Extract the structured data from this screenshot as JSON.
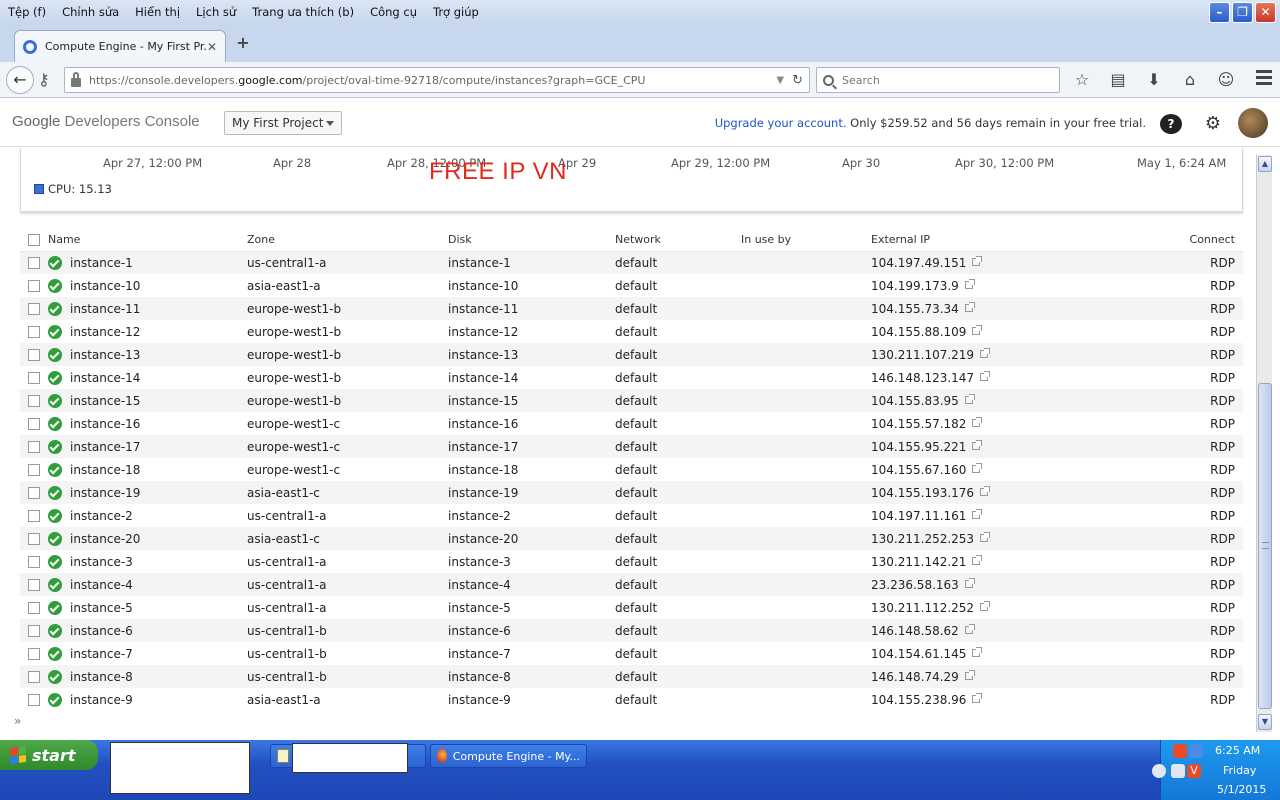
{
  "menubar": {
    "items": [
      "Tệp (f)",
      "Chỉnh sửa",
      "Hiển thị",
      "Lịch sử",
      "Trang ưa thích (b)",
      "Công cụ",
      "Trợ giúp"
    ]
  },
  "tab": {
    "title": "Compute Engine - My First Pr..."
  },
  "address_bar": {
    "url_prefix": "https://console.developers.",
    "url_domain": "google.com",
    "url_suffix": "/project/oval-time-92718/compute/instances?graph=GCE_CPU"
  },
  "search": {
    "placeholder": "Search"
  },
  "console": {
    "brand_google": "Google",
    "brand_product": "Developers Console",
    "project": "My First Project",
    "upgrade_link": "Upgrade your account.",
    "trial_text": " Only $259.52 and 56 days remain in your free trial."
  },
  "chart": {
    "x_ticks": [
      "Apr 27, 12:00 PM",
      "Apr 28",
      "Apr 28, 12:00 PM",
      "Apr 29",
      "Apr 29, 12:00 PM",
      "Apr 30",
      "Apr 30, 12:00 PM",
      "May 1, 6:24 AM"
    ],
    "legend": "CPU: 15.13",
    "legend_color": "#3a6fd8",
    "watermark": "FREE IP VN"
  },
  "table": {
    "headers": {
      "name": "Name",
      "zone": "Zone",
      "disk": "Disk",
      "network": "Network",
      "in_use_by": "In use by",
      "external_ip": "External IP",
      "connect": "Connect"
    },
    "rows": [
      {
        "name": "instance-1",
        "zone": "us-central1-a",
        "disk": "instance-1",
        "network": "default",
        "ip": "104.197.49.151",
        "connect": "RDP"
      },
      {
        "name": "instance-10",
        "zone": "asia-east1-a",
        "disk": "instance-10",
        "network": "default",
        "ip": "104.199.173.9",
        "connect": "RDP"
      },
      {
        "name": "instance-11",
        "zone": "europe-west1-b",
        "disk": "instance-11",
        "network": "default",
        "ip": "104.155.73.34",
        "connect": "RDP"
      },
      {
        "name": "instance-12",
        "zone": "europe-west1-b",
        "disk": "instance-12",
        "network": "default",
        "ip": "104.155.88.109",
        "connect": "RDP"
      },
      {
        "name": "instance-13",
        "zone": "europe-west1-b",
        "disk": "instance-13",
        "network": "default",
        "ip": "130.211.107.219",
        "connect": "RDP"
      },
      {
        "name": "instance-14",
        "zone": "europe-west1-b",
        "disk": "instance-14",
        "network": "default",
        "ip": "146.148.123.147",
        "connect": "RDP"
      },
      {
        "name": "instance-15",
        "zone": "europe-west1-b",
        "disk": "instance-15",
        "network": "default",
        "ip": "104.155.83.95",
        "connect": "RDP"
      },
      {
        "name": "instance-16",
        "zone": "europe-west1-c",
        "disk": "instance-16",
        "network": "default",
        "ip": "104.155.57.182",
        "connect": "RDP"
      },
      {
        "name": "instance-17",
        "zone": "europe-west1-c",
        "disk": "instance-17",
        "network": "default",
        "ip": "104.155.95.221",
        "connect": "RDP"
      },
      {
        "name": "instance-18",
        "zone": "europe-west1-c",
        "disk": "instance-18",
        "network": "default",
        "ip": "104.155.67.160",
        "connect": "RDP"
      },
      {
        "name": "instance-19",
        "zone": "asia-east1-c",
        "disk": "instance-19",
        "network": "default",
        "ip": "104.155.193.176",
        "connect": "RDP"
      },
      {
        "name": "instance-2",
        "zone": "us-central1-a",
        "disk": "instance-2",
        "network": "default",
        "ip": "104.197.11.161",
        "connect": "RDP"
      },
      {
        "name": "instance-20",
        "zone": "asia-east1-c",
        "disk": "instance-20",
        "network": "default",
        "ip": "130.211.252.253",
        "connect": "RDP"
      },
      {
        "name": "instance-3",
        "zone": "us-central1-a",
        "disk": "instance-3",
        "network": "default",
        "ip": "130.211.142.21",
        "connect": "RDP"
      },
      {
        "name": "instance-4",
        "zone": "us-central1-a",
        "disk": "instance-4",
        "network": "default",
        "ip": "23.236.58.163",
        "connect": "RDP"
      },
      {
        "name": "instance-5",
        "zone": "us-central1-a",
        "disk": "instance-5",
        "network": "default",
        "ip": "130.211.112.252",
        "connect": "RDP"
      },
      {
        "name": "instance-6",
        "zone": "us-central1-b",
        "disk": "instance-6",
        "network": "default",
        "ip": "146.148.58.62",
        "connect": "RDP"
      },
      {
        "name": "instance-7",
        "zone": "us-central1-b",
        "disk": "instance-7",
        "network": "default",
        "ip": "104.154.61.145",
        "connect": "RDP"
      },
      {
        "name": "instance-8",
        "zone": "us-central1-b",
        "disk": "instance-8",
        "network": "default",
        "ip": "146.148.74.29",
        "connect": "RDP"
      },
      {
        "name": "instance-9",
        "zone": "asia-east1-a",
        "disk": "instance-9",
        "network": "default",
        "ip": "104.155.238.96",
        "connect": "RDP"
      }
    ]
  },
  "taskbar": {
    "start_label": "start",
    "firefox_task": "Compute Engine - My...",
    "clock_time": "6:25 AM",
    "clock_day": "Friday",
    "clock_date": "5/1/2015"
  }
}
